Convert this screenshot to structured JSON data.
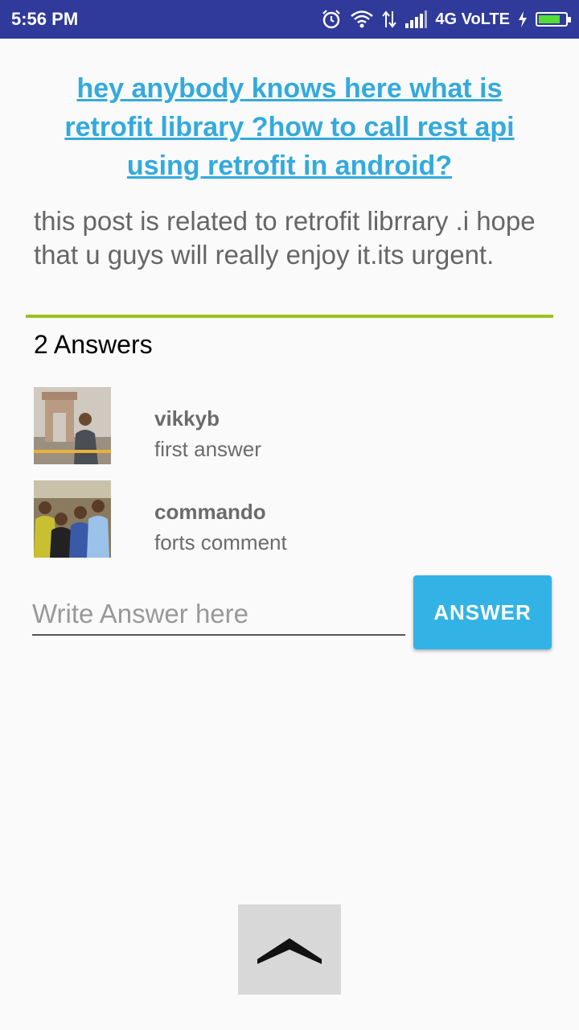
{
  "status_bar": {
    "time": "5:56 PM",
    "network": "4G VoLTE",
    "icons": [
      "alarm-icon",
      "wifi-icon",
      "data-arrows-icon",
      "signal-icon",
      "charging-icon",
      "battery-icon"
    ]
  },
  "question": {
    "title": "hey anybody knows here what is retrofit library ?how to call rest api using retrofit in android?",
    "description": "this post is related to retrofit librrary .i hope that u guys will really enjoy it.its urgent."
  },
  "answers_count": "2 Answers",
  "answers": [
    {
      "user": "vikkyb",
      "text": "first answer"
    },
    {
      "user": "commando",
      "text": "forts comment"
    }
  ],
  "answer_form": {
    "placeholder": "Write Answer here",
    "value": "",
    "button_label": "ANSWER"
  },
  "colors": {
    "status_bar": "#2f3a9a",
    "title_link": "#33aadd",
    "divider": "#99c41c",
    "button": "#33b3e5"
  }
}
